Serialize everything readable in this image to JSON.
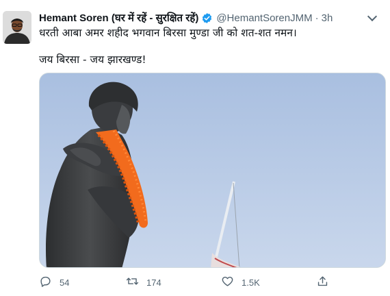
{
  "tweet": {
    "display_name": "Hemant Soren (घर में रहें - सुरक्षित रहें)",
    "handle": "@HemantSorenJMM",
    "separator": "·",
    "time": "3h",
    "text_line1": "धरती आबा अमर शहीद भगवान बिरसा मुण्डा जी को शत-शत नमन।",
    "text_line2": "जय बिरसा - जय झारखण्ड!"
  },
  "actions": {
    "reply_count": "54",
    "retweet_count": "174",
    "like_count": "1.5K"
  },
  "icons": {
    "verified": "verified-badge-icon",
    "more": "chevron-down-icon",
    "reply": "reply-icon",
    "retweet": "retweet-icon",
    "like": "heart-icon",
    "share": "share-icon"
  },
  "colors": {
    "verified_blue": "#1d9bf0",
    "secondary_text": "#536471",
    "sky": "#b8c9e2",
    "garland": "#f26b1d"
  }
}
